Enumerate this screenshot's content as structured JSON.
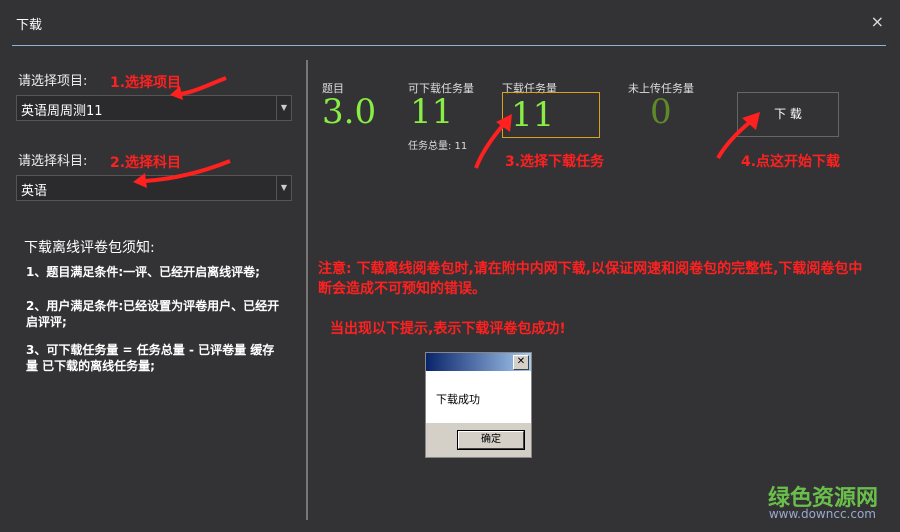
{
  "window": {
    "title": "下载",
    "close_glyph": "×"
  },
  "left": {
    "project_label": "请选择项目:",
    "project_value": "英语周周测11",
    "subject_label": "请选择科目:",
    "subject_value": "英语",
    "hint1": "1.选择项目",
    "hint2": "2.选择科目",
    "notice_title": "下载离线评卷包须知:",
    "notice1": "1、题目满足条件:一评、已经开启离线评卷;",
    "notice2": "2、用户满足条件:已经设置为评卷用户、已经开启评评;",
    "notice3": "3、可下载任务量 = 任务总量 - 已评卷量 缓存量 已下载的离线任务量;"
  },
  "stats": {
    "q_label": "题目",
    "q_value": "3.0",
    "avail_label": "可下载任务量",
    "avail_value": "11",
    "total_text": "任务总量: 11",
    "dl_label": "下载任务量",
    "dl_value": "11",
    "pending_label": "未上传任务量",
    "pending_value": "0",
    "download_button": "下 载",
    "hint3": "3.选择下载任务",
    "hint4": "4.点这开始下载"
  },
  "messages": {
    "warning": "注意: 下载离线阅卷包时,请在附中内网下载,以保证网速和阅卷包的完整性,下载阅卷包中断会造成不可预知的错误。",
    "success_prompt": "当出现以下提示,表示下载评卷包成功!"
  },
  "dialog": {
    "message": "下载成功",
    "ok_label": "确定",
    "close_glyph": "✕"
  },
  "watermark": {
    "brand": "绿色资源网",
    "url": "www.downcc.com"
  },
  "colors": {
    "accent_green": "#88ee44",
    "annotation_red": "#ff2020",
    "highlight_border": "#d8a020"
  }
}
